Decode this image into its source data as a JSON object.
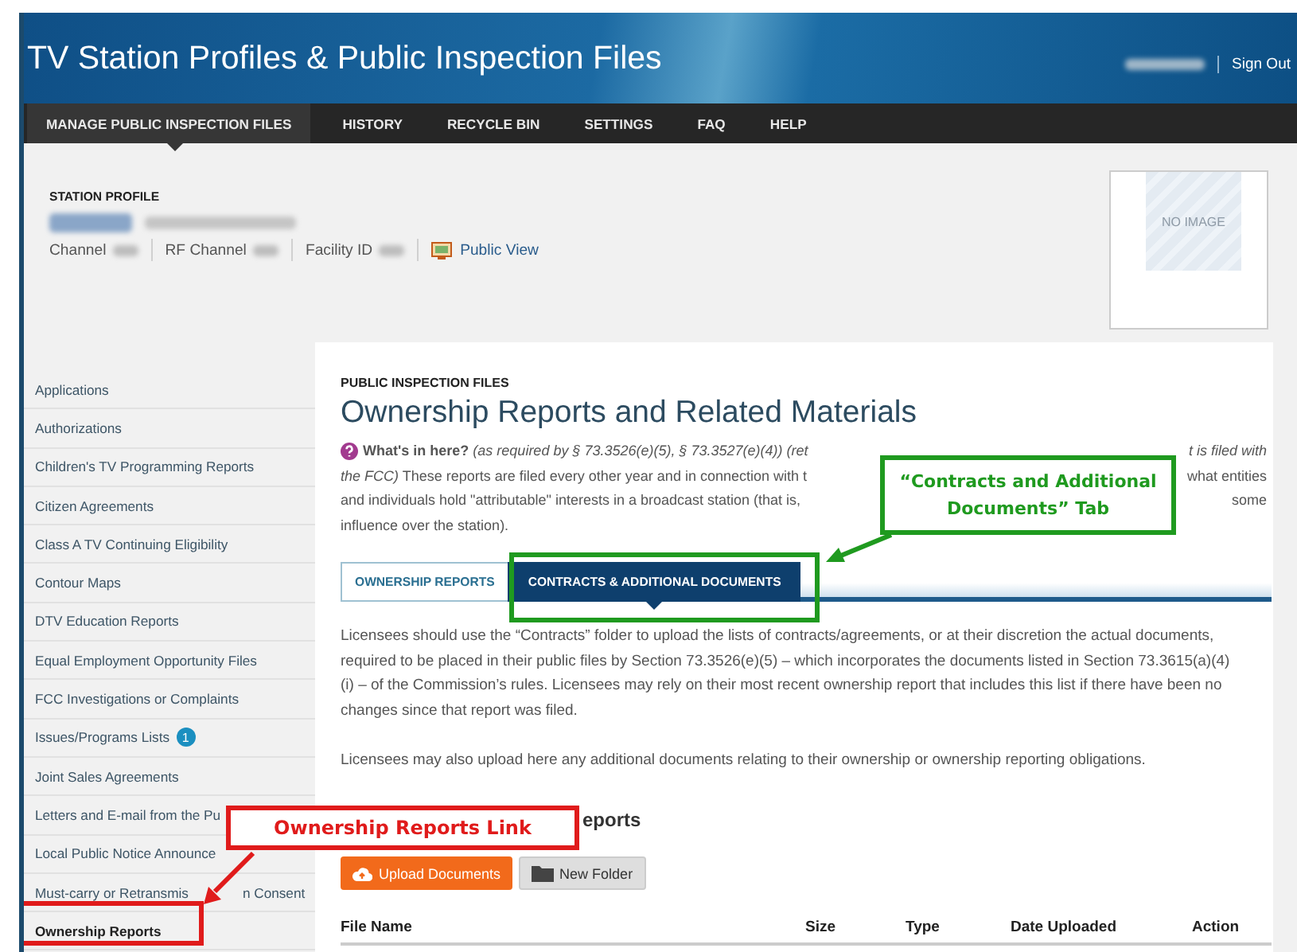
{
  "header": {
    "title": "TV Station Profiles & Public Inspection Files",
    "sign_out": "Sign Out"
  },
  "nav": [
    {
      "label": "MANAGE PUBLIC INSPECTION FILES",
      "selected": true
    },
    {
      "label": "HISTORY",
      "selected": false
    },
    {
      "label": "RECYCLE BIN",
      "selected": false
    },
    {
      "label": "SETTINGS",
      "selected": false
    },
    {
      "label": "FAQ",
      "selected": false
    },
    {
      "label": "HELP",
      "selected": false
    }
  ],
  "station_profile": {
    "heading": "STATION PROFILE",
    "fields": [
      "Channel",
      "RF Channel",
      "Facility ID"
    ],
    "public_view": "Public View",
    "no_image": "NO IMAGE"
  },
  "sidebar": [
    {
      "label": "Applications",
      "selected": false
    },
    {
      "label": "Authorizations",
      "selected": false
    },
    {
      "label": "Children's TV Programming Reports",
      "selected": false
    },
    {
      "label": "Citizen Agreements",
      "selected": false
    },
    {
      "label": "Class A TV Continuing Eligibility",
      "selected": false
    },
    {
      "label": "Contour Maps",
      "selected": false
    },
    {
      "label": "DTV Education Reports",
      "selected": false
    },
    {
      "label": "Equal Employment Opportunity Files",
      "selected": false
    },
    {
      "label": "FCC Investigations or Complaints",
      "selected": false
    },
    {
      "label": "Issues/Programs Lists",
      "selected": false,
      "badge": "1"
    },
    {
      "label": "Joint Sales Agreements",
      "selected": false
    },
    {
      "label": "Letters and E-mail from the Pu",
      "selected": false
    },
    {
      "label": "Local Public Notice Announce",
      "selected": false
    },
    {
      "label": "Must-carry or Retransmis",
      "label_tail": "n Consent",
      "selected": false
    },
    {
      "label": "Ownership Reports",
      "selected": true
    }
  ],
  "main": {
    "eyebrow": "PUBLIC INSPECTION FILES",
    "title": "Ownership Reports and Related Materials",
    "help_lines": [
      {
        "left": "**What's in here?** *(as required by § 73.3526(e)(5), § 73.3527(e)(4)) (ret*",
        "right": "*t is filed with*"
      },
      {
        "left": "*the FCC)*  These reports are filed every other year and in connection with t",
        "right": "what entities"
      },
      {
        "left": "and individuals hold \"attributable\" interests in a broadcast station (that is,",
        "right": "some"
      },
      {
        "left": "influence over the station)."
      }
    ],
    "tabs": [
      {
        "label": "OWNERSHIP REPORTS",
        "selected": false
      },
      {
        "label": "CONTRACTS & ADDITIONAL DOCUMENTS",
        "selected": true
      }
    ],
    "paragraphs": [
      "Licensees should use the “Contracts” folder to upload the lists of contracts/agreements, or at their discretion the actual documents, required to be placed in their public files by Section 73.3526(e)(5) – which incorporates the documents listed in Section 73.3615(a)(4)(i) – of the Commission’s rules.  Licensees may rely on their most recent ownership report that includes this list if there have been no changes since that report was filed.",
      "Licensees may also upload here any additional documents relating to their ownership or ownership reporting obligations."
    ],
    "section_title": "eports",
    "buttons": [
      {
        "label": "Upload Documents",
        "kind": "primary"
      },
      {
        "label": "New Folder",
        "kind": "secondary"
      }
    ],
    "table": {
      "columns": [
        "File Name",
        "Size",
        "Type",
        "Date Uploaded",
        "Action"
      ]
    }
  },
  "annotations": [
    {
      "text": "“Contracts and Additional Documents” Tab",
      "color": "#1f9a1f"
    },
    {
      "text": "Ownership Reports Link",
      "color": "#e01b1b"
    }
  ]
}
